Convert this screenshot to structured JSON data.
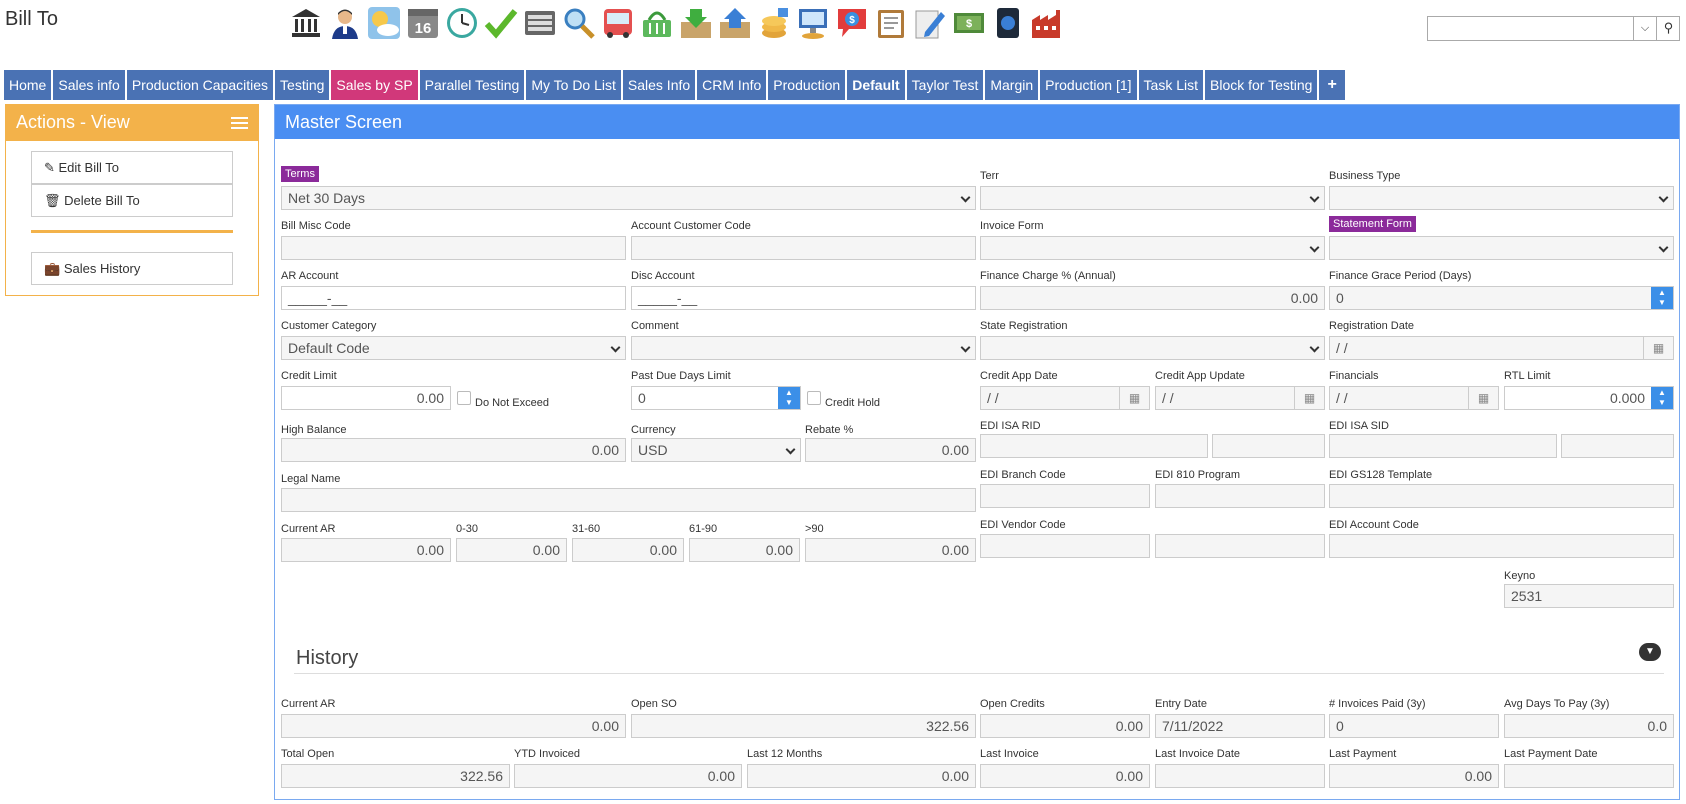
{
  "app": {
    "title": "Bill To"
  },
  "toolbar": {
    "icons": [
      "bank-icon",
      "user-icon",
      "weather-icon",
      "calendar-16-icon",
      "clock-icon",
      "checkmark-icon",
      "keyboard-icon",
      "magnifier-icon",
      "bus-icon",
      "basket-icon",
      "inbox-download-icon",
      "inbox-upload-icon",
      "coins-icon",
      "computer-icon",
      "dollar-chat-icon",
      "clipboard-icon",
      "edit-document-icon",
      "money-icon",
      "phone-icon",
      "factory-icon"
    ]
  },
  "search": {
    "value": ""
  },
  "tabs": [
    "Home",
    "Sales info",
    "Production Capacities",
    "Testing",
    "Sales by SP",
    "Parallel Testing",
    "My To Do List",
    "Sales Info",
    "CRM Info",
    "Production",
    "Default",
    "Taylor Test",
    "Margin",
    "Production [1]",
    "Task List",
    "Block for Testing",
    "+"
  ],
  "actions": {
    "title": "Actions - View",
    "edit": "Edit Bill To",
    "delete": "Delete Bill To",
    "history": "Sales History"
  },
  "master": {
    "title": "Master Screen"
  },
  "labels": {
    "terms": "Terms",
    "terr": "Terr",
    "business_type": "Business Type",
    "bill_misc": "Bill Misc Code",
    "acct_cust": "Account Customer Code",
    "invoice_form": "Invoice Form",
    "statement_form": "Statement Form",
    "ar_account": "AR Account",
    "disc_account": "Disc Account",
    "finance_charge": "Finance Charge % (Annual)",
    "finance_grace": "Finance Grace Period (Days)",
    "cust_cat": "Customer Category",
    "comment": "Comment",
    "state_reg": "State Registration",
    "reg_date": "Registration Date",
    "credit_limit": "Credit Limit",
    "do_not_exceed": "Do Not Exceed",
    "past_due": "Past Due Days Limit",
    "credit_hold": "Credit Hold",
    "credit_app_date": "Credit App Date",
    "credit_app_update": "Credit App Update",
    "financials": "Financials",
    "rtl_limit": "RTL Limit",
    "high_balance": "High Balance",
    "currency": "Currency",
    "rebate": "Rebate %",
    "edi_isa_rid": "EDI ISA RID",
    "edi_isa_sid": "EDI ISA SID",
    "legal_name": "Legal Name",
    "edi_branch": "EDI Branch Code",
    "edi_810": "EDI 810 Program",
    "edi_gs128": "EDI GS128 Template",
    "current_ar": "Current AR",
    "b0_30": "0-30",
    "b31_60": "31-60",
    "b61_90": "61-90",
    "b90": ">90",
    "edi_vendor": "EDI Vendor Code",
    "edi_account": "EDI Account Code",
    "keyno": "Keyno"
  },
  "values": {
    "terms": "Net 30 Days",
    "ar_account": "_____-__",
    "disc_account": "_____-__",
    "finance_charge": "0.00",
    "finance_grace": "0",
    "cust_cat": "Default Code",
    "reg_date": " /  /",
    "credit_limit": "0.00",
    "past_due": "0",
    "credit_app_date": " /  /",
    "credit_app_update": " /  /",
    "financials": " /  /",
    "rtl_limit": "0.000",
    "high_balance": "0.00",
    "currency": "USD",
    "rebate": "0.00",
    "current_ar": "0.00",
    "b0_30": "0.00",
    "b31_60": "0.00",
    "b61_90": "0.00",
    "b90": "0.00",
    "keyno": "2531"
  },
  "history": {
    "title": "History",
    "labels": {
      "current_ar": "Current AR",
      "open_so": "Open SO",
      "open_credits": "Open Credits",
      "entry_date": "Entry Date",
      "invoices_paid": "# Invoices Paid (3y)",
      "avg_days": "Avg Days To Pay (3y)",
      "total_open": "Total Open",
      "ytd_invoiced": "YTD Invoiced",
      "last_12": "Last 12 Months",
      "last_invoice": "Last Invoice",
      "last_invoice_date": "Last Invoice Date",
      "last_payment": "Last Payment",
      "last_payment_date": "Last Payment Date"
    },
    "values": {
      "current_ar": "0.00",
      "open_so": "322.56",
      "open_credits": "0.00",
      "entry_date": "7/11/2022",
      "invoices_paid": "0",
      "avg_days": "0.0",
      "total_open": "322.56",
      "ytd_invoiced": "0.00",
      "last_12": "0.00",
      "last_invoice": "0.00",
      "last_invoice_date": "",
      "last_payment": "0.00",
      "last_payment_date": ""
    }
  },
  "colors": {
    "tab": "#4a72b4",
    "tab_active": "#d1387a",
    "actions": "#f3b24a",
    "master": "#4a8ef2",
    "badge": "#8b2a9a"
  }
}
